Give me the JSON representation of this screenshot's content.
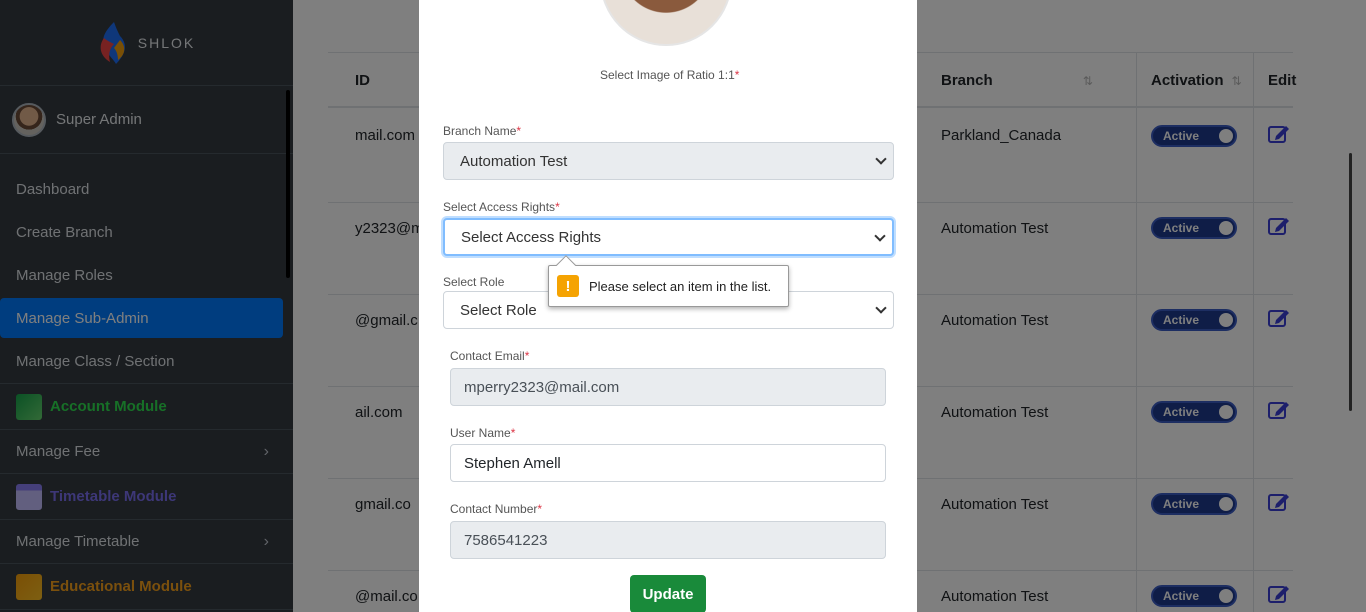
{
  "brand": {
    "name": "SHLOK"
  },
  "user": {
    "name": "Super Admin"
  },
  "sidebar": {
    "items": [
      {
        "label": "Dashboard"
      },
      {
        "label": "Create Branch"
      },
      {
        "label": "Manage Roles"
      },
      {
        "label": "Manage Sub-Admin"
      },
      {
        "label": "Manage Class / Section"
      }
    ],
    "modules": {
      "account": {
        "label": "Account Module"
      },
      "manage_fee": {
        "label": "Manage Fee",
        "chevron": "›"
      },
      "timetable": {
        "label": "Timetable Module"
      },
      "manage_timetable": {
        "label": "Manage Timetable",
        "chevron": "›"
      },
      "educational": {
        "label": "Educational Module"
      }
    }
  },
  "table": {
    "headers": {
      "id": "ID",
      "branch": "Branch",
      "activation": "Activation",
      "edit": "Edit"
    },
    "sort_icon": "⇅",
    "rows": [
      {
        "email": "mail.com",
        "branch": "Parkland_Canada",
        "status": "Active"
      },
      {
        "email": "y2323@m",
        "branch": "Automation Test",
        "status": "Active"
      },
      {
        "email": "@gmail.c",
        "branch": "Automation Test",
        "status": "Active"
      },
      {
        "email": "ail.com",
        "branch": "Automation Test",
        "status": "Active"
      },
      {
        "email": "gmail.co",
        "branch": "Automation Test",
        "status": "Active"
      },
      {
        "email": "@mail.co",
        "branch": "Automation Test",
        "status": "Active"
      }
    ]
  },
  "modal": {
    "photo_caption": "Select Image of Ratio 1:1",
    "required_mark": "*",
    "branch_name": {
      "label": "Branch Name",
      "value": "Automation Test"
    },
    "access_rights": {
      "label": "Select Access Rights",
      "value": "Select Access Rights"
    },
    "role": {
      "label": "Select Role",
      "value": "Select Role"
    },
    "contact_email": {
      "label": "Contact Email",
      "value": "mperry2323@mail.com"
    },
    "user_name": {
      "label": "User Name",
      "value": "Stephen Amell"
    },
    "contact_number": {
      "label": "Contact Number",
      "value": "7586541223"
    },
    "update_label": "Update"
  },
  "tooltip": {
    "icon": "!",
    "text": "Please select an item in the list."
  },
  "colors": {
    "sidebar_bg": "#343a40",
    "active_item": "#007bff",
    "update_btn": "#198a3a",
    "warning": "#f5a302"
  }
}
